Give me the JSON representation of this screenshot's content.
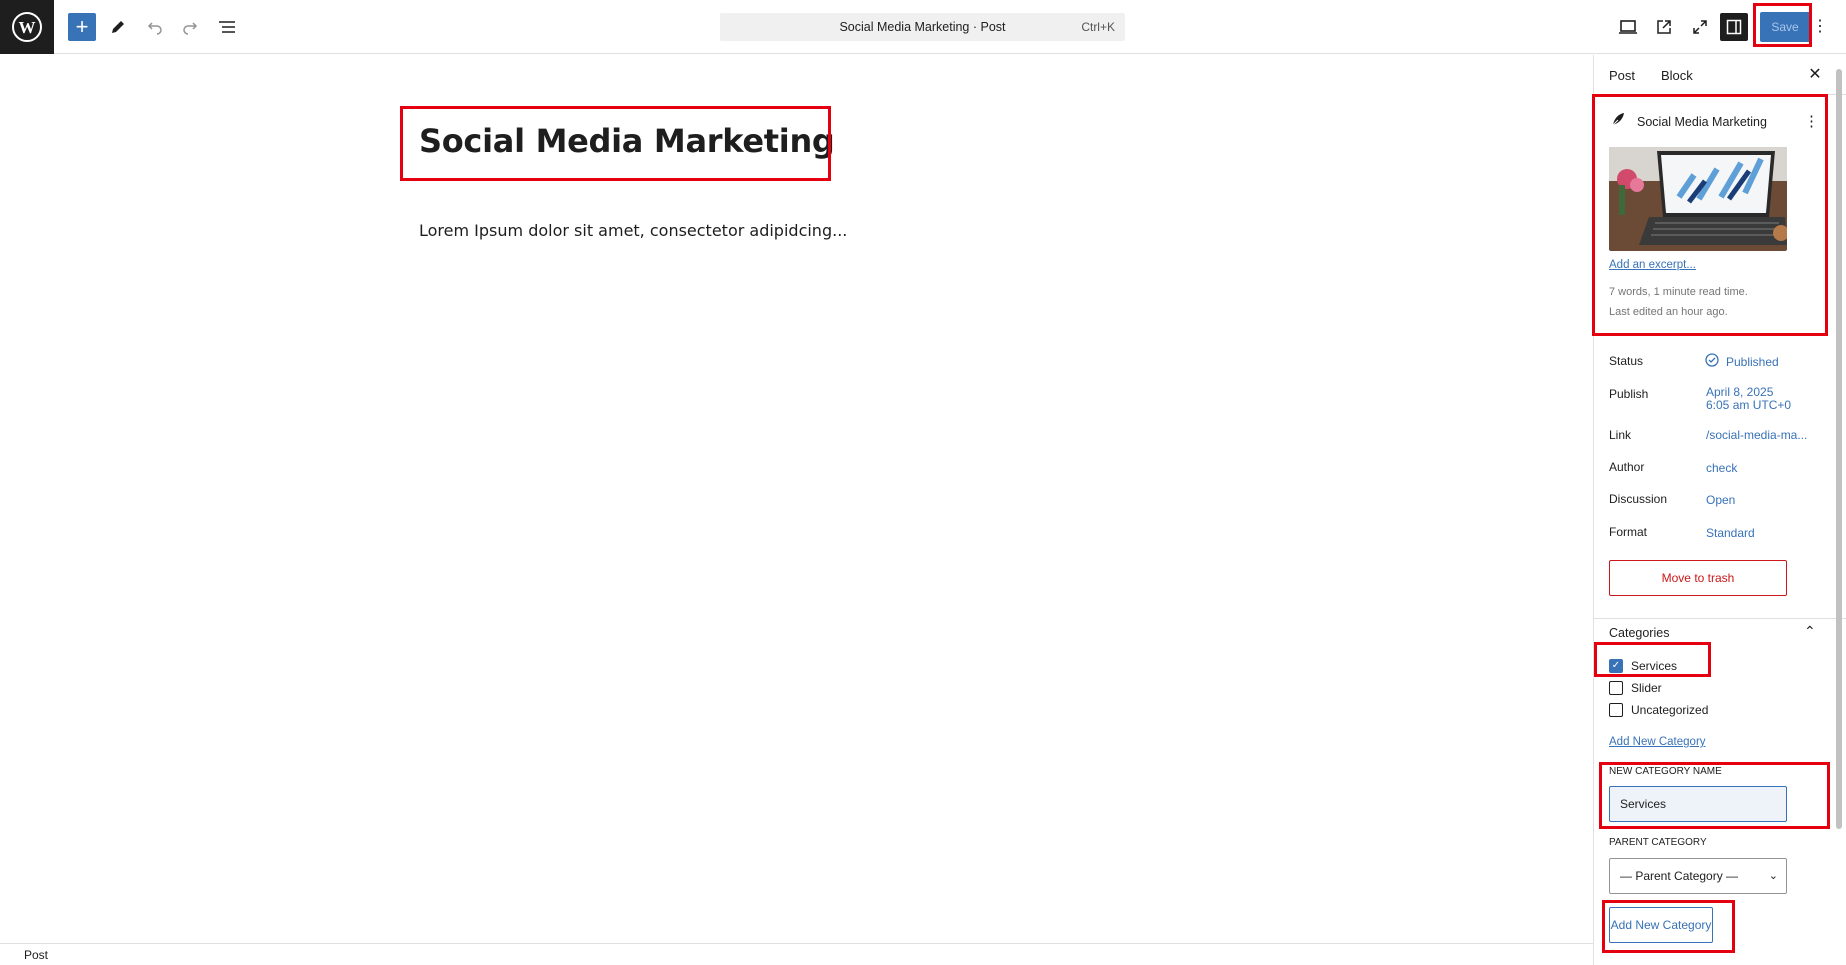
{
  "topbar": {
    "command_title": "Social Media Marketing · Post",
    "command_shortcut": "Ctrl+K",
    "save_label": "Save",
    "add_block_icon": "plus-icon",
    "tools_icon": "pencil-icon",
    "undo_icon": "undo-icon",
    "redo_icon": "redo-icon",
    "list_view_icon": "list-view-icon",
    "view_icon": "desktop-icon",
    "preview_icon": "external-link-icon",
    "fullscreen_icon": "fullscreen-icon",
    "settings_icon": "sidebar-toggle-icon",
    "options_icon": "more-vertical-icon"
  },
  "editor": {
    "title": "Social Media Marketing",
    "body": "Lorem Ipsum dolor sit amet, consectetor adipidcing..."
  },
  "footer": {
    "breadcrumb": "Post"
  },
  "sidebar": {
    "tabs": [
      "Post",
      "Block"
    ],
    "summary": {
      "title": "Social Media Marketing",
      "add_excerpt": "Add an excerpt...",
      "word_count": "7 words, 1 minute read time.",
      "last_edited": "Last edited an hour ago."
    },
    "rows": [
      {
        "label": "Status",
        "value": "Published"
      },
      {
        "label": "Publish",
        "value": "April 8, 2025",
        "value2": "6:05 am UTC+0"
      },
      {
        "label": "Link",
        "value": "/social-media-ma..."
      },
      {
        "label": "Author",
        "value": "check"
      },
      {
        "label": "Discussion",
        "value": "Open"
      },
      {
        "label": "Format",
        "value": "Standard"
      }
    ],
    "move_to_trash": "Move to trash",
    "categories": {
      "heading": "Categories",
      "items": [
        {
          "label": "Services",
          "checked": true
        },
        {
          "label": "Slider",
          "checked": false
        },
        {
          "label": "Uncategorized",
          "checked": false
        }
      ],
      "add_new_link": "Add New Category",
      "new_name_label": "New Category Name",
      "new_name_value": "Services",
      "parent_label": "Parent Category",
      "parent_selected": "— Parent Category —",
      "add_button": "Add New Category"
    }
  },
  "colors": {
    "accent": "#3872b7",
    "highlight": "#e4000f",
    "danger": "#cc1818"
  }
}
